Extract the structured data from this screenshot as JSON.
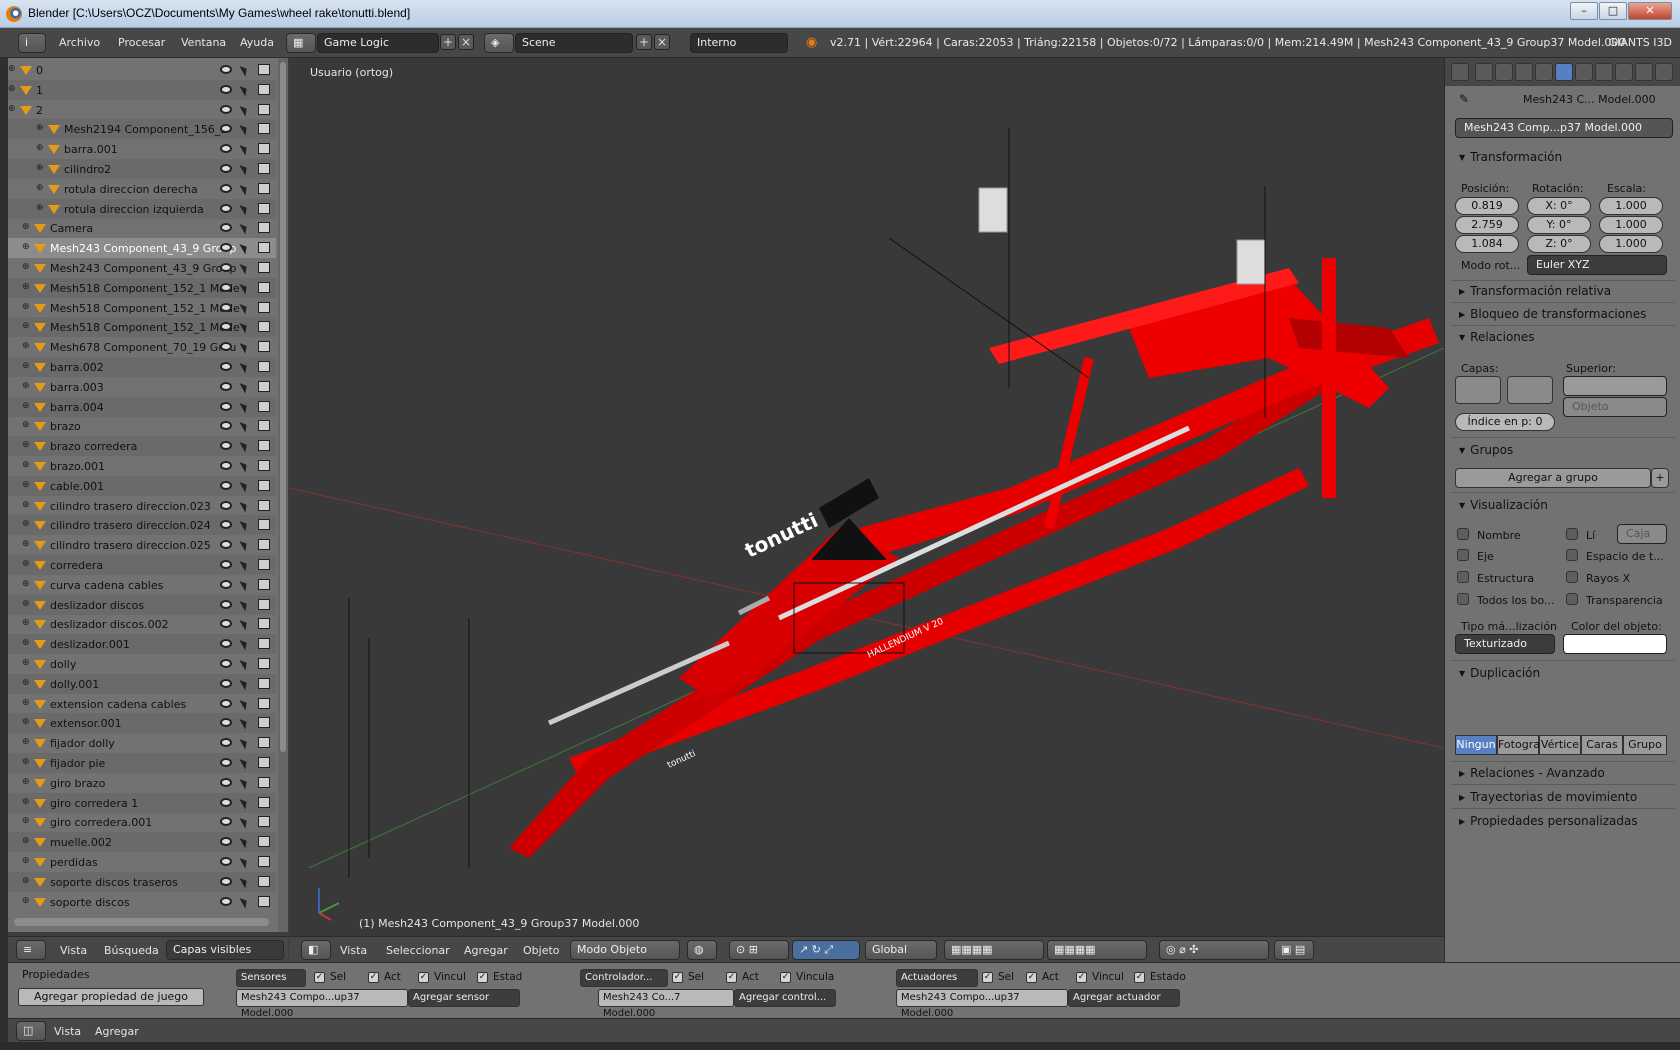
{
  "window": {
    "title": "Blender [C:\\Users\\OCZ\\Documents\\My Games\\wheel rake\\tonutti.blend]",
    "min": "–",
    "max": "□",
    "close": "✕"
  },
  "info": {
    "menus": [
      "Archivo",
      "Procesar",
      "Ventana",
      "Ayuda"
    ],
    "screen_layout": "Game Logic",
    "scene": "Scene",
    "render_engine": "Interno",
    "stats": "v2.71 | Vért:22964 | Caras:22053 | Triáng:22158 | Objetos:0/72 | Lámparas:0/0 | Mem:214.49M | Mesh243 Component_43_9 Group37 Model.000",
    "addon": "GIANTS I3D"
  },
  "outliner": {
    "rows": [
      {
        "label": "0",
        "indent": 0
      },
      {
        "label": "1",
        "indent": 0
      },
      {
        "label": "2",
        "indent": 0
      },
      {
        "label": "Mesh2194 Component_156_3",
        "indent": 2
      },
      {
        "label": "barra.001",
        "indent": 2
      },
      {
        "label": "cilindro2",
        "indent": 2
      },
      {
        "label": "rotula direccion derecha",
        "indent": 2
      },
      {
        "label": "rotula direccion izquierda",
        "indent": 2
      },
      {
        "label": "Camera",
        "indent": 1
      },
      {
        "label": "Mesh243 Component_43_9 Group",
        "indent": 1,
        "selected": true
      },
      {
        "label": "Mesh243 Component_43_9 Group",
        "indent": 1
      },
      {
        "label": "Mesh518 Component_152_1 Mode",
        "indent": 1
      },
      {
        "label": "Mesh518 Component_152_1 Mode",
        "indent": 1
      },
      {
        "label": "Mesh518 Component_152_1 Mode",
        "indent": 1
      },
      {
        "label": "Mesh678 Component_70_19 Grou",
        "indent": 1
      },
      {
        "label": "barra.002",
        "indent": 1
      },
      {
        "label": "barra.003",
        "indent": 1
      },
      {
        "label": "barra.004",
        "indent": 1
      },
      {
        "label": "brazo",
        "indent": 1
      },
      {
        "label": "brazo corredera",
        "indent": 1
      },
      {
        "label": "brazo.001",
        "indent": 1
      },
      {
        "label": "cable.001",
        "indent": 1
      },
      {
        "label": "cilindro trasero direccion.023",
        "indent": 1
      },
      {
        "label": "cilindro trasero direccion.024",
        "indent": 1
      },
      {
        "label": "cilindro trasero direccion.025",
        "indent": 1
      },
      {
        "label": "corredera",
        "indent": 1
      },
      {
        "label": "curva cadena cables",
        "indent": 1
      },
      {
        "label": "deslizador discos",
        "indent": 1
      },
      {
        "label": "deslizador discos.002",
        "indent": 1
      },
      {
        "label": "deslizador.001",
        "indent": 1
      },
      {
        "label": "dolly",
        "indent": 1
      },
      {
        "label": "dolly.001",
        "indent": 1
      },
      {
        "label": "extension cadena cables",
        "indent": 1
      },
      {
        "label": "extensor.001",
        "indent": 1
      },
      {
        "label": "fijador dolly",
        "indent": 1
      },
      {
        "label": "fijador pie",
        "indent": 1
      },
      {
        "label": "giro brazo",
        "indent": 1
      },
      {
        "label": "giro corredera 1",
        "indent": 1
      },
      {
        "label": "giro corredera.001",
        "indent": 1
      },
      {
        "label": "muelle.002",
        "indent": 1
      },
      {
        "label": "perdidas",
        "indent": 1
      },
      {
        "label": "soporte  discos traseros",
        "indent": 1
      },
      {
        "label": "soporte discos",
        "indent": 1
      }
    ],
    "header": {
      "view": "Vista",
      "search": "Búsqueda",
      "filter": "Capas visibles"
    }
  },
  "viewport": {
    "view_label": "Usuario (ortog)",
    "active_object": "(1) Mesh243 Component_43_9 Group37 Model.000",
    "header": {
      "view": "Vista",
      "select": "Seleccionar",
      "add": "Agregar",
      "object": "Objeto",
      "mode": "Modo Objeto",
      "orientation": "Global"
    },
    "brand_text_1": "tonutti",
    "brand_text_2": "HALLENDIUM  V 20",
    "brand_text_3": "tonutti"
  },
  "properties": {
    "breadcrumb": "Mesh243 C... Model.000",
    "object_name": "Mesh243 Comp...p37 Model.000",
    "transform": {
      "title": "Transformación",
      "pos_label": "Posición:",
      "rot_label": "Rotación:",
      "scale_label": "Escala:",
      "pos": [
        "0.819",
        "2.759",
        "1.084"
      ],
      "rot": [
        "X:",
        "0°",
        "Y:",
        "0°",
        "Z:",
        "0°"
      ],
      "scale": [
        "1.000",
        "1.000",
        "1.000"
      ],
      "rot_mode_label": "Modo rot...",
      "rot_mode": "Euler XYZ"
    },
    "closed_panels_1": [
      "Transformación relativa",
      "Bloqueo de transformaciones"
    ],
    "relations": {
      "title": "Relaciones",
      "layers": "Capas:",
      "parent": "Superior:",
      "parent_type": "Objeto",
      "pass_index": "Índice en p: 0"
    },
    "groups": {
      "title": "Grupos",
      "add": "Agregar a grupo",
      "plus": "+"
    },
    "display": {
      "title": "Visualización",
      "left": [
        "Nombre",
        "Eje",
        "Estructura",
        "Todos los bo..."
      ],
      "right": [
        "Lí",
        "Espacio de t...",
        "Rayos X",
        "Transparencia"
      ],
      "bounds_type": "Caja",
      "max_draw_label": "Tipo má...lización",
      "max_draw": "Texturizado",
      "color_label": "Color del objeto:"
    },
    "duplication": {
      "title": "Duplicación",
      "options": [
        "Ningun",
        "Fotogra",
        "Vértice",
        "Caras",
        "Grupo"
      ]
    },
    "closed_panels_2": [
      "Relaciones - Avanzado",
      "Trayectorias de movimiento",
      "Propiedades personalizadas"
    ]
  },
  "logic": {
    "properties_title": "Propiedades",
    "add_game_prop": "Agregar propiedad de juego",
    "sensors": {
      "sel": "Sensores",
      "flags": [
        "Sel",
        "Act",
        "Vincul",
        "Estad"
      ],
      "obj": "Mesh243 Compo...up37 Model.000",
      "add": "Agregar sensor"
    },
    "controllers": {
      "sel": "Controlador...",
      "flags": [
        "Sel",
        "Act",
        "Vincula"
      ],
      "obj": "Mesh243 Co...7 Model.000",
      "add": "Agregar control..."
    },
    "actuators": {
      "sel": "Actuadores",
      "flags": [
        "Sel",
        "Act",
        "Vincul",
        "Estado"
      ],
      "obj": "Mesh243 Compo...up37 Model.000",
      "add": "Agregar actuador"
    },
    "header": {
      "view": "Vista",
      "add": "Agregar"
    }
  },
  "colors": {
    "model_red": "#e60000",
    "bg": "#393939",
    "accent": "#5680c2"
  }
}
